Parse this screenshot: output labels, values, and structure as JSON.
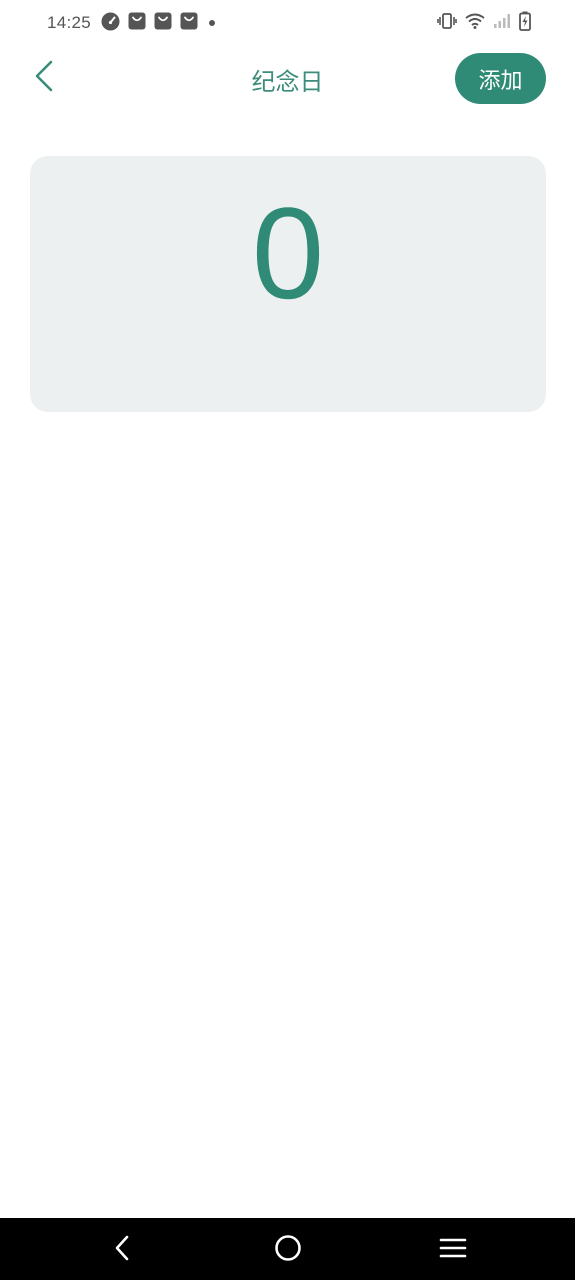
{
  "status_bar": {
    "time": "14:25",
    "left_icons": [
      "speedometer-icon",
      "shopping-bag-icon",
      "shopping-bag-icon",
      "shopping-bag-icon",
      "dot-icon"
    ],
    "right_icons": [
      "vibrate-icon",
      "wifi-icon",
      "signal-icon",
      "battery-charging-icon"
    ]
  },
  "header": {
    "title": "纪念日",
    "add_label": "添加",
    "back_icon": "chevron-left-icon"
  },
  "card": {
    "count": "0"
  },
  "nav_bar": {
    "items": [
      "back-nav-icon",
      "home-nav-icon",
      "menu-nav-icon"
    ]
  },
  "colors": {
    "accent": "#2f8b75",
    "title": "#3b8c7a",
    "card_bg": "#ecf0f0",
    "nav_bg": "#000000"
  }
}
